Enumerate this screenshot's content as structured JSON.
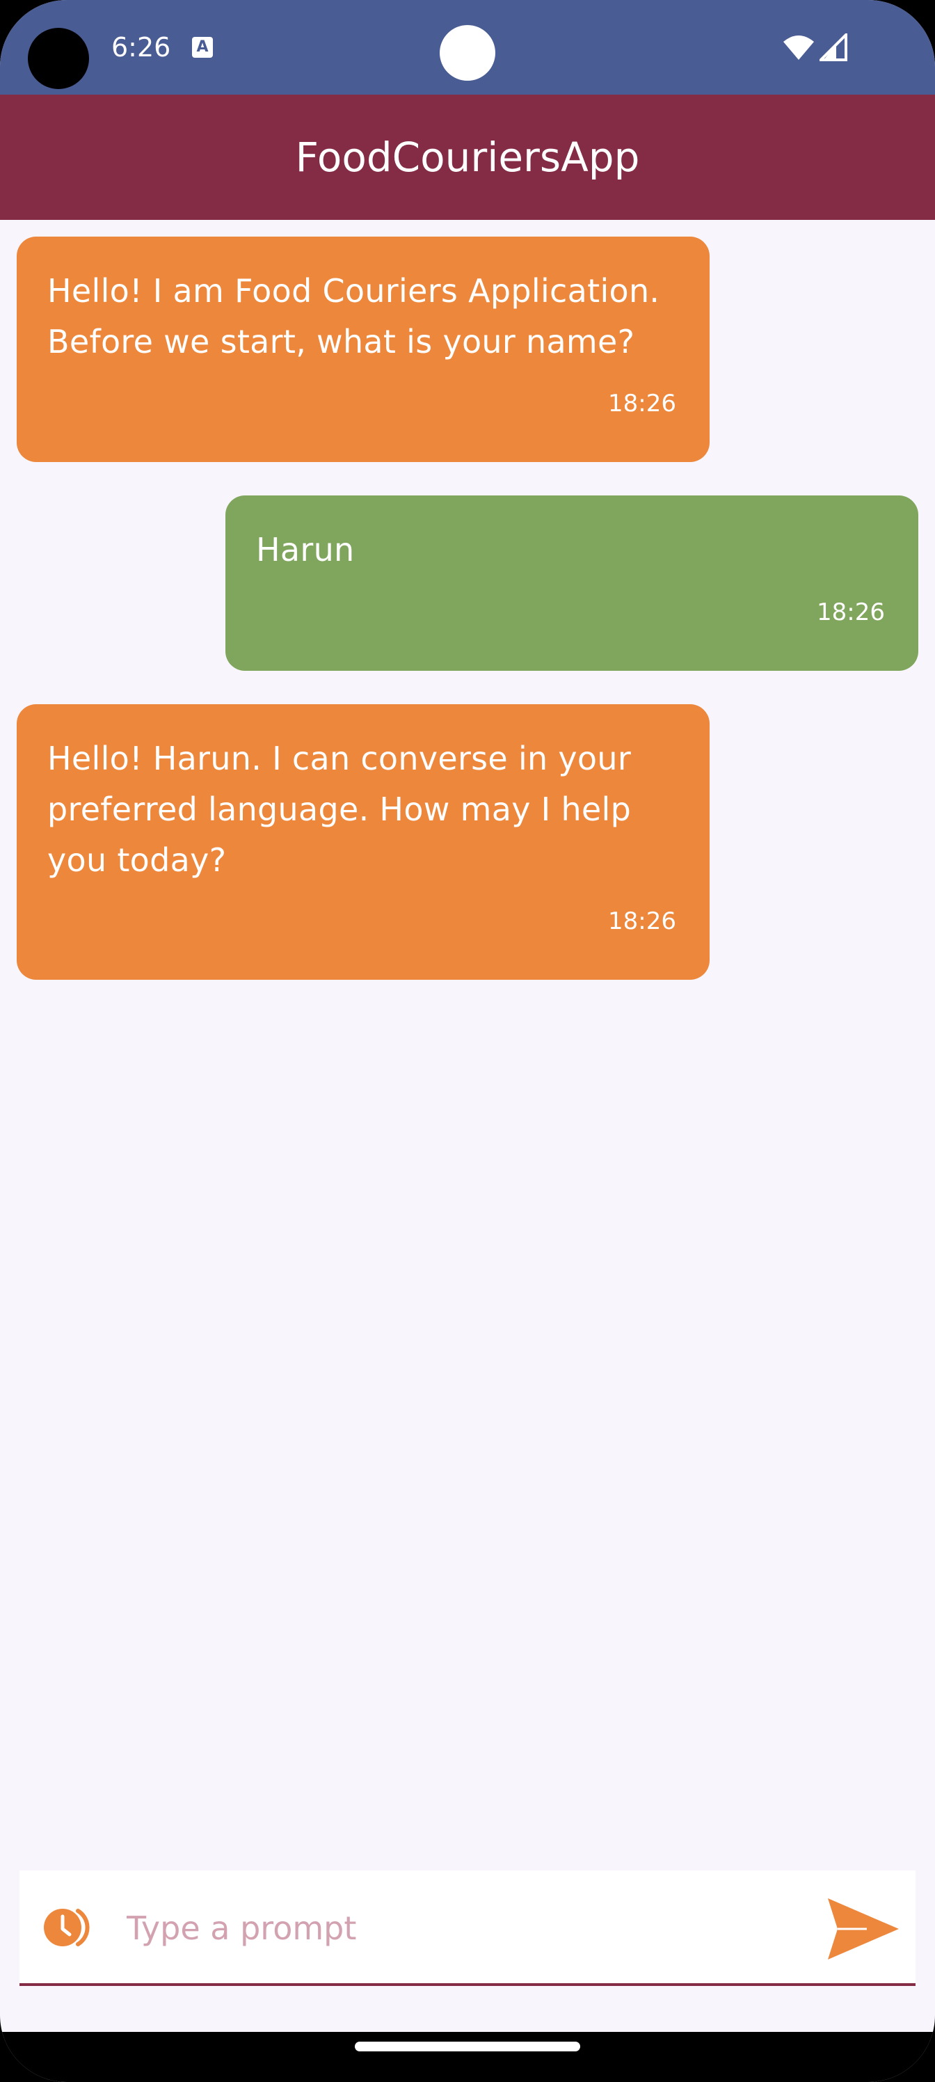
{
  "status_bar": {
    "time": "6:26",
    "a_badge": "A"
  },
  "app_bar": {
    "title": "FoodCouriersApp"
  },
  "messages": [
    {
      "sender": "bot",
      "text": "Hello! I am Food Couriers Application. Before we start, what is your name?",
      "time": "18:26"
    },
    {
      "sender": "user",
      "text": "Harun",
      "time": "18:26"
    },
    {
      "sender": "bot",
      "text": "Hello! Harun. I can converse in your preferred language. How may I help you today?",
      "time": "18:26"
    }
  ],
  "input": {
    "placeholder": "Type a prompt",
    "value": ""
  },
  "icons": {
    "history": "history-icon",
    "send": "send-icon",
    "wifi": "wifi-icon",
    "signal": "signal-icon"
  },
  "colors": {
    "status_bar": "#4a5c94",
    "app_bar": "#842b46",
    "bot_bubble": "#ec873c",
    "user_bubble": "#80a55d",
    "accent": "#ec873c",
    "background": "#f8f6fc"
  }
}
